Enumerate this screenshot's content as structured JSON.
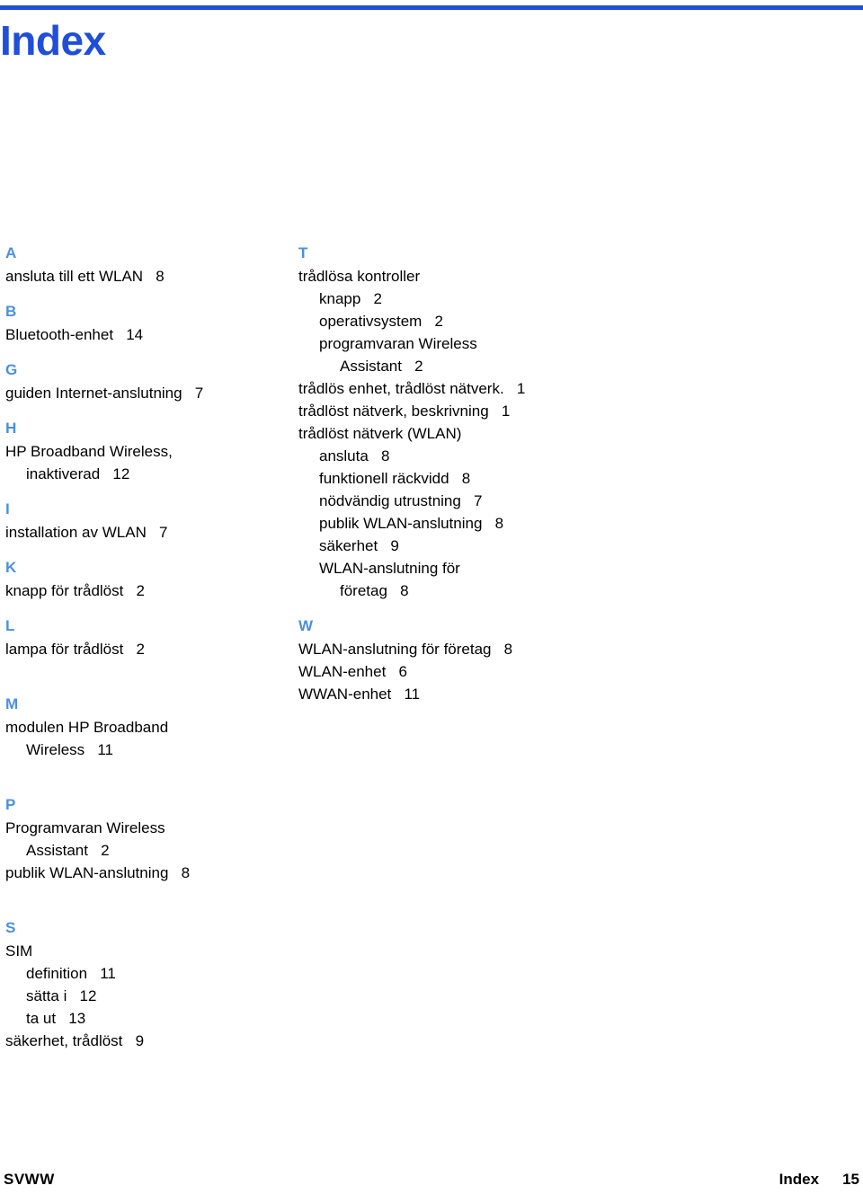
{
  "document": {
    "title": "Index",
    "accent_color": "#1f4ed8",
    "letter_color": "#4a90e2",
    "footer": {
      "left": "SVWW",
      "section": "Index",
      "page": "15"
    }
  },
  "left_column": [
    {
      "letter": "A",
      "entries": [
        {
          "text": "ansluta till ett WLAN   8",
          "indent": 0
        }
      ]
    },
    {
      "letter": "B",
      "entries": [
        {
          "text": "Bluetooth-enhet   14",
          "indent": 0
        }
      ]
    },
    {
      "letter": "G",
      "entries": [
        {
          "text": "guiden Internet-anslutning   7",
          "indent": 0
        }
      ]
    },
    {
      "letter": "H",
      "entries": [
        {
          "text": "HP Broadband Wireless,",
          "indent": 0
        },
        {
          "text": "inaktiverad   12",
          "indent": 1
        }
      ]
    },
    {
      "letter": "I",
      "entries": [
        {
          "text": "installation av WLAN   7",
          "indent": 0
        }
      ]
    },
    {
      "letter": "K",
      "entries": [
        {
          "text": "knapp för trådlöst   2",
          "indent": 0
        }
      ]
    },
    {
      "letter": "L",
      "entries": [
        {
          "text": "lampa för trådlöst   2",
          "indent": 0
        }
      ]
    },
    {
      "letter": "M",
      "entries": [
        {
          "text": "modulen HP Broadband",
          "indent": 0
        },
        {
          "text": "Wireless   11",
          "indent": 1
        }
      ]
    },
    {
      "letter": "P",
      "entries": [
        {
          "text": "Programvaran Wireless",
          "indent": 0
        },
        {
          "text": "Assistant   2",
          "indent": 1
        },
        {
          "text": "publik WLAN-anslutning   8",
          "indent": 0
        }
      ]
    },
    {
      "letter": "S",
      "entries": [
        {
          "text": "SIM",
          "indent": 0
        },
        {
          "text": "definition   11",
          "indent": 1
        },
        {
          "text": "sätta i   12",
          "indent": 1
        },
        {
          "text": "ta ut   13",
          "indent": 1
        },
        {
          "text": "säkerhet, trådlöst   9",
          "indent": 0
        }
      ]
    }
  ],
  "right_column": [
    {
      "letter": "T",
      "entries": [
        {
          "text": "trådlösa kontroller",
          "indent": 0
        },
        {
          "text": "knapp   2",
          "indent": 1
        },
        {
          "text": "operativsystem   2",
          "indent": 1
        },
        {
          "text": "programvaran Wireless",
          "indent": 1
        },
        {
          "text": "Assistant   2",
          "indent": 2
        },
        {
          "text": "trådlös enhet, trådlöst nätverk.   1",
          "indent": 0
        },
        {
          "text": "trådlöst nätverk, beskrivning   1",
          "indent": 0
        },
        {
          "text": "trådlöst nätverk (WLAN)",
          "indent": 0
        },
        {
          "text": "ansluta   8",
          "indent": 1
        },
        {
          "text": "funktionell räckvidd   8",
          "indent": 1
        },
        {
          "text": "nödvändig utrustning   7",
          "indent": 1
        },
        {
          "text": "publik WLAN-anslutning   8",
          "indent": 1
        },
        {
          "text": "säkerhet   9",
          "indent": 1
        },
        {
          "text": "WLAN-anslutning för",
          "indent": 1
        },
        {
          "text": "företag   8",
          "indent": 2
        }
      ]
    },
    {
      "letter": "W",
      "entries": [
        {
          "text": "WLAN-anslutning för företag   8",
          "indent": 0
        },
        {
          "text": "WLAN-enhet   6",
          "indent": 0
        },
        {
          "text": "WWAN-enhet   11",
          "indent": 0
        }
      ]
    }
  ]
}
